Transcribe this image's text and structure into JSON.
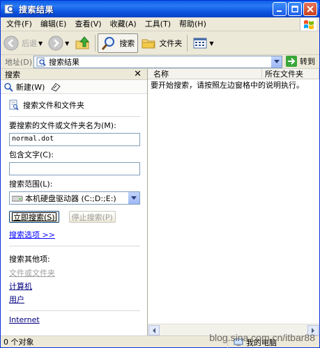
{
  "window": {
    "title": "搜索结果"
  },
  "menu": [
    "文件(F)",
    "编辑(E)",
    "查看(V)",
    "收藏(A)",
    "工具(T)",
    "帮助(H)"
  ],
  "toolbar": {
    "back": "后退",
    "search": "搜索",
    "folders": "文件夹"
  },
  "address": {
    "label": "地址(D)",
    "value": "搜索结果",
    "go": "转到"
  },
  "pane": {
    "title": "搜索",
    "new_label": "新建(W)",
    "section_title": "搜索文件和文件夹",
    "filename_label": "要搜索的文件或文件夹名为(M):",
    "filename_value": "normal.dot",
    "contains_label": "包含文字(C):",
    "contains_value": "",
    "lookin_label": "搜索范围(L):",
    "lookin_value": "本机硬盘驱动器 (C:;D:;E:)",
    "search_now": "立即搜索(S)",
    "stop_search": "停止搜索(P)",
    "options_link": "搜索选项 >>",
    "other_title": "搜索其他项:",
    "other_items": [
      "文件或文件夹",
      "计算机",
      "用户",
      "Internet"
    ]
  },
  "results": {
    "columns": [
      "名称",
      "所在文件夹"
    ],
    "hint": "要开始搜索，请按照左边窗格中的说明执行。"
  },
  "status": {
    "left": "0 个对象",
    "right": "我的电脑"
  },
  "watermark": "blog.sina.com.cn/itbar88",
  "colors": {
    "titlebar": "#0a52de",
    "link": "#0000ff",
    "chrome": "#ece9d8"
  }
}
